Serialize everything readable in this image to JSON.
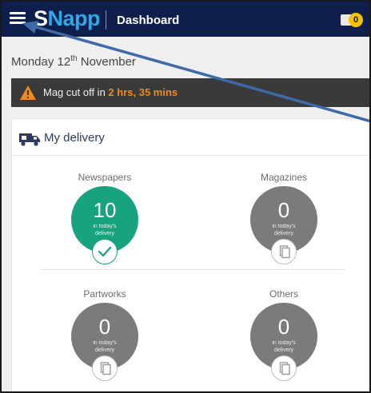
{
  "header": {
    "logo_prefix": "S",
    "logo_accent": "Napp",
    "title": "Dashboard",
    "notifications_count": "0"
  },
  "date": {
    "day": "Monday 12",
    "suffix": "th",
    "month": "November"
  },
  "alert": {
    "text": "Mag cut off in ",
    "highlight": "2 hrs, 35 mins"
  },
  "delivery": {
    "title": "My delivery",
    "tiles": [
      {
        "label": "Newspapers",
        "count": "10",
        "sub": "in today's delivery",
        "status": "delivered",
        "color": "#17a37e"
      },
      {
        "label": "Magazines",
        "count": "0",
        "sub": "in today's delivery",
        "status": "copy",
        "color": "#7b7b7b"
      },
      {
        "label": "Partworks",
        "count": "0",
        "sub": "in today's delivery",
        "status": "copy",
        "color": "#7b7b7b"
      },
      {
        "label": "Others",
        "count": "0",
        "sub": "in today's delivery",
        "status": "copy",
        "color": "#7b7b7b"
      }
    ]
  },
  "colors": {
    "topbar": "#0f1f4b",
    "accent": "#2fa7e8",
    "alert_highlight": "#f08a1c",
    "success": "#17a37e"
  }
}
